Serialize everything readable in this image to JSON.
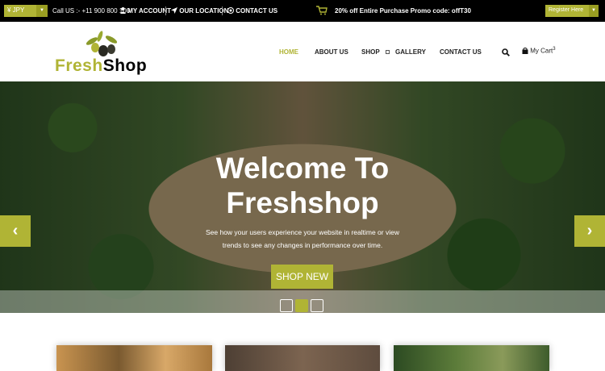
{
  "topbar": {
    "currency": "¥ JPY",
    "call": "Call US :- +11 900 800 100",
    "account": "MY ACCOUNT",
    "location": "OUR LOCATION",
    "contact": "CONTACT US",
    "promo": "20% off Entire Purchase Promo code: offT30",
    "register": "Register Here"
  },
  "logo": {
    "fresh": "Fresh",
    "shop": "Shop"
  },
  "nav": {
    "home": "HOME",
    "about": "ABOUT US",
    "shop": "SHOP",
    "gallery": "GALLERY",
    "contact": "CONTACT US",
    "cart": "My Cart",
    "cart_count": "3"
  },
  "hero": {
    "title_line1": "Welcome To",
    "title_line2": "Freshshop",
    "subtitle": "See how your users experience your website in realtime or view trends to see any changes in performance over time.",
    "button": "SHOP NEW",
    "slide_count": 3,
    "active_slide": 2
  },
  "colors": {
    "accent": "#b0b435",
    "topbar_bg": "#000000"
  }
}
